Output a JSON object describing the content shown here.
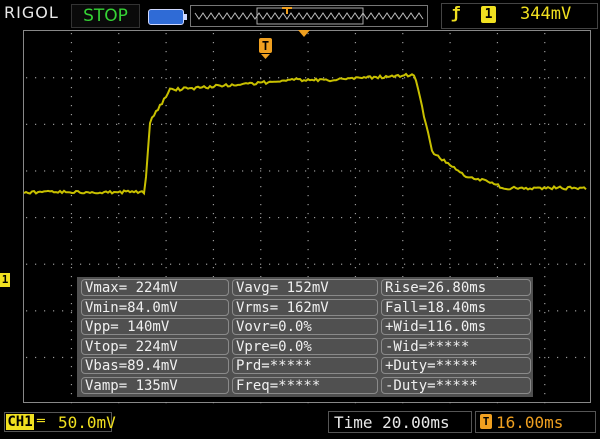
{
  "header": {
    "brand": "RIGOL",
    "run_state": "STOP",
    "trigger_slope_icon": "rising-edge-icon",
    "trigger_channel": "1",
    "trigger_level": "344mV"
  },
  "screen": {
    "trigger_marker": "T",
    "channel_marker": "1",
    "trace_color": "#c8c000"
  },
  "measurements": [
    [
      "Vmax= 224mV",
      "Vavg= 152mV",
      "Rise=26.80ms"
    ],
    [
      "Vmin=84.0mV",
      "Vrms= 162mV",
      "Fall=18.40ms"
    ],
    [
      "Vpp= 140mV",
      "Vovr=0.0%",
      "+Wid=116.0ms"
    ],
    [
      "Vtop= 224mV",
      "Vpre=0.0%",
      "-Wid=*****"
    ],
    [
      "Vbas=89.4mV",
      "Prd=*****",
      "+Duty=*****"
    ],
    [
      "Vamp= 135mV",
      "Freq=*****",
      "-Duty=*****"
    ]
  ],
  "footer": {
    "channel_tag": "CH1",
    "coupling_icon": "dc-coupling-icon",
    "channel_scale": "50.0mV",
    "timebase": "Time 20.00ms",
    "trigger_offset_icon": "trigger-offset-icon",
    "trigger_offset": "16.00ms"
  },
  "colors": {
    "trace": "#c8c000",
    "accent_yellow": "#f0e020",
    "run_state_green": "#35d235",
    "trigger_orange": "#f0a020"
  }
}
